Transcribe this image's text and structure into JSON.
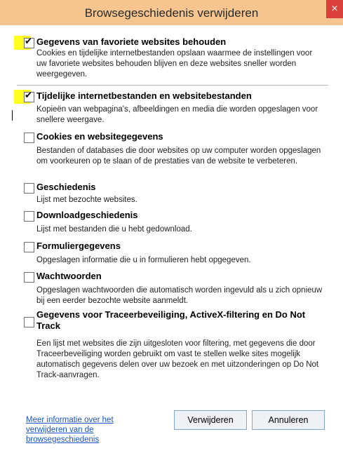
{
  "window": {
    "title": "Browsegeschiedenis verwijderen",
    "close_label": "×"
  },
  "options": [
    {
      "label": "Gegevens van favoriete websites behouden",
      "checked": true,
      "description": "Cookies en tijdelijke internetbestanden opslaan waarmee de instellingen voor uw favoriete websites behouden blijven en deze websites sneller worden weergegeven."
    },
    {
      "label": "Tijdelijke internetbestanden en websitebestanden",
      "checked": true,
      "description": "Kopieën van webpagina's, afbeeldingen en media die worden opgeslagen voor snellere weergave."
    },
    {
      "label": "Cookies en websitegegevens",
      "checked": false,
      "description": "Bestanden of databases die door websites op uw computer worden opgeslagen om voorkeuren op te slaan of de prestaties van de website te verbeteren."
    },
    {
      "label": "Geschiedenis",
      "checked": false,
      "description": "Lijst met bezochte websites."
    },
    {
      "label": "Downloadgeschiedenis",
      "checked": false,
      "description": "Lijst met bestanden die u hebt gedownload."
    },
    {
      "label": "Formuliergegevens",
      "checked": false,
      "description": "Opgeslagen informatie die u in formulieren hebt opgegeven."
    },
    {
      "label": "Wachtwoorden",
      "checked": false,
      "description": "Opgeslagen wachtwoorden die automatisch worden ingevuld als u zich opnieuw bij een eerder bezochte website aanmeldt."
    },
    {
      "label": "Gegevens voor Traceerbeveiliging, ActiveX-filtering en Do Not Track",
      "checked": false,
      "description": "Een lijst met websites die zijn uitgesloten voor filtering, met gegevens die door Traceerbeveiliging worden gebruikt om vast te stellen welke sites mogelijk automatisch gegevens delen over uw bezoek en met uitzonderingen op Do Not Track-aanvragen."
    }
  ],
  "footer": {
    "link_text": "Meer informatie over het verwijderen van de browsegeschiedenis",
    "delete_label": "Verwijderen",
    "cancel_label": "Annuleren"
  },
  "colors": {
    "title_bar": "#f6c58f",
    "highlight": "#ffff22",
    "link": "#1a55c8"
  }
}
